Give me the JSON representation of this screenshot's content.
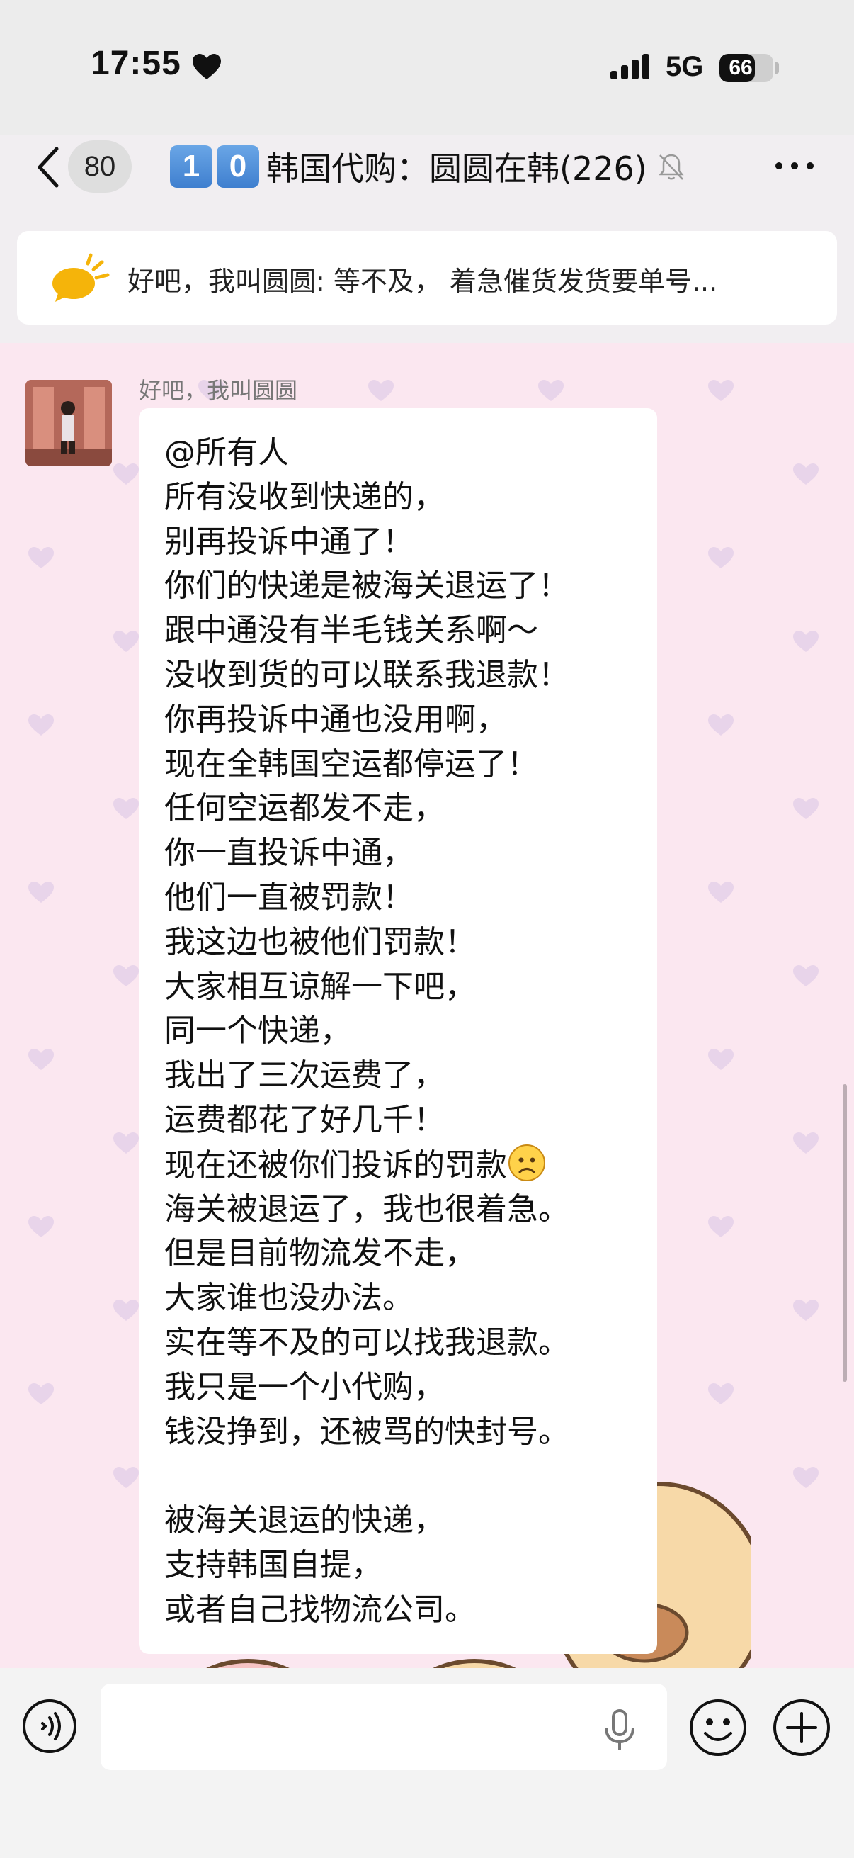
{
  "status_bar": {
    "time": "17:55",
    "network": "5G",
    "battery": "66",
    "battery_level": 0.66
  },
  "nav": {
    "unread_count": "80",
    "title_digits": [
      "1",
      "0"
    ],
    "title": "韩国代购：圆圆在韩(226)"
  },
  "notice": {
    "text": "好吧，我叫圆圆: 等不及， 着急催货发货要单号..."
  },
  "message": {
    "sender": "好吧，我叫圆圆",
    "lines": [
      "@所有人",
      "所有没收到快递的，",
      "别再投诉中通了！",
      "你们的快递是被海关退运了！",
      "跟中通没有半毛钱关系啊～",
      "没收到货的可以联系我退款！",
      "你再投诉中通也没用啊，",
      "现在全韩国空运都停运了！",
      "任何空运都发不走，",
      "你一直投诉中通，",
      "他们一直被罚款！",
      "我这边也被他们罚款！",
      "大家相互谅解一下吧，",
      "同一个快递，",
      "我出了三次运费了，",
      "运费都花了好几千！",
      "现在还被你们投诉的罚款",
      "海关被退运了，我也很着急。",
      "但是目前物流发不走，",
      "大家谁也没办法。",
      "实在等不及的可以找我退款。",
      "我只是一个小代购，",
      "钱没挣到，还被骂的快封号。",
      "",
      "被海关退运的快递，",
      "支持韩国自提，",
      "或者自己找物流公司。"
    ]
  },
  "colors": {
    "chat_bg": "#fbe7f0",
    "accent_title": "#3f7fcf",
    "notice_icon": "#f5b40a"
  },
  "icons": {
    "back": "chevron-left-icon",
    "more": "more-dots-icon",
    "mute": "bell-slash-icon",
    "voice": "voice-icon",
    "mic": "mic-icon",
    "emoji": "emoji-icon",
    "plus": "plus-icon"
  }
}
